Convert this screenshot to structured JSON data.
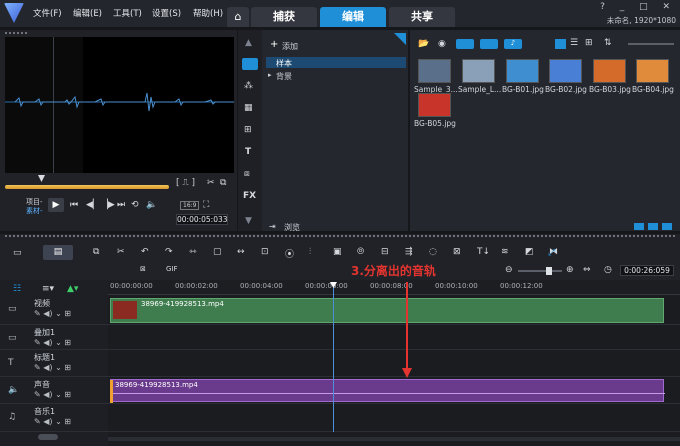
{
  "menu": {
    "items": [
      "文件(F)",
      "编辑(E)",
      "工具(T)",
      "设置(S)",
      "帮助(H)"
    ]
  },
  "tabs": [
    {
      "label": "捕获"
    },
    {
      "label": "编辑"
    },
    {
      "label": "共享"
    }
  ],
  "window": {
    "controls": "?  _  □  ✕",
    "project_info": "未命名, 1920*1080"
  },
  "player": {
    "mode_label_1": "项目-",
    "mode_label_2": "素材-",
    "timecode": "00:00:05:033",
    "ratio": "16:9"
  },
  "library": {
    "add_label": "添加",
    "tree": [
      {
        "label": "样本"
      },
      {
        "label": "背景"
      }
    ],
    "browse_label": "浏览",
    "files": [
      {
        "name": "Sample_3...",
        "color": "#5a6f8a"
      },
      {
        "name": "Sample_L...",
        "color": "#8aa0b8"
      },
      {
        "name": "BG-B01.jpg",
        "color": "#3f8fd0"
      },
      {
        "name": "BG-B02.jpg",
        "color": "#4a7fd6"
      },
      {
        "name": "BG-B03.jpg",
        "color": "#d46b2a"
      },
      {
        "name": "BG-B04.jpg",
        "color": "#e08a3c"
      },
      {
        "name": "BG-B05.jpg",
        "color": "#c8342a"
      }
    ]
  },
  "timeline": {
    "zoom_timecode": "0:00:26:059",
    "ruler": [
      "00:00:00:00",
      "00:00:02:00",
      "00:00:04:00",
      "00:00:06:00",
      "00:00:08:00",
      "00:00:10:00",
      "00:00:12:00"
    ],
    "annotation": "3.分离出的音轨",
    "tracks": [
      {
        "name": "视频",
        "clip": "38969-419928513.mp4"
      },
      {
        "name": "叠加1"
      },
      {
        "name": "标题1"
      },
      {
        "name": "声音",
        "clip": "38969-419928513.mp4"
      },
      {
        "name": "音乐1"
      }
    ]
  },
  "colors": {
    "accent": "#1f8fd8",
    "video_clip": "#3f7d4f",
    "audio_clip": "#6a3a8c",
    "annotation": "#e3342f"
  }
}
